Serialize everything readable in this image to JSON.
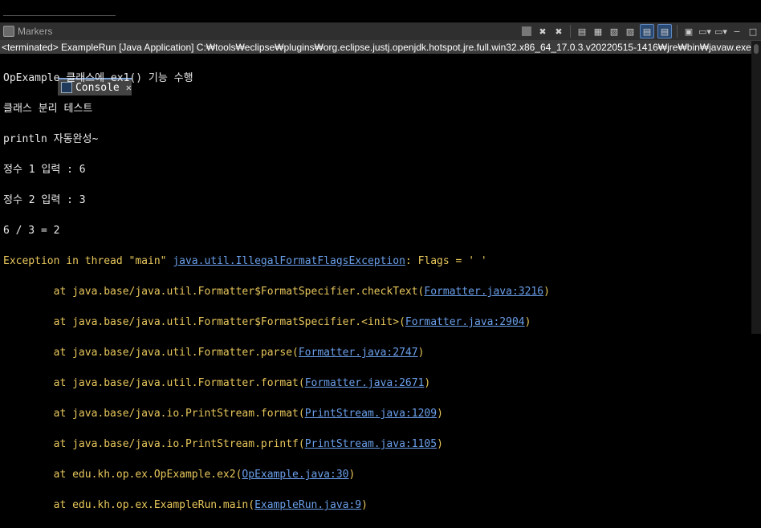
{
  "tabs": {
    "markers": "Markers",
    "console": "Console",
    "close": "✕"
  },
  "status_line": "<terminated> ExampleRun [Java Application] C:₩tools₩eclipse₩plugins₩org.eclipse.justj.openjdk.hotspot.jre.full.win32.x86_64_17.0.3.v20220515-1416₩jre₩bin₩javaw.exe  (20",
  "console": {
    "output_lines": [
      "OpExample 클래스에 ex1() 기능 수행",
      "클래스 분리 테스트",
      "println 자동완성~",
      "정수 1 입력 : 6",
      "정수 2 입력 : 3",
      "6 / 3 = 2"
    ],
    "exception": {
      "prefix": "Exception in thread \"main\" ",
      "type": "java.util.IllegalFormatFlagsException",
      "message": ": Flags = ' '"
    },
    "stack": [
      {
        "at": "\tat java.base/java.util.Formatter$FormatSpecifier.checkText(",
        "link": "Formatter.java:3216",
        "end": ")"
      },
      {
        "at": "\tat java.base/java.util.Formatter$FormatSpecifier.<init>(",
        "link": "Formatter.java:2904",
        "end": ")"
      },
      {
        "at": "\tat java.base/java.util.Formatter.parse(",
        "link": "Formatter.java:2747",
        "end": ")"
      },
      {
        "at": "\tat java.base/java.util.Formatter.format(",
        "link": "Formatter.java:2671",
        "end": ")"
      },
      {
        "at": "\tat java.base/java.io.PrintStream.format(",
        "link": "PrintStream.java:1209",
        "end": ")"
      },
      {
        "at": "\tat java.base/java.io.PrintStream.printf(",
        "link": "PrintStream.java:1105",
        "end": ")"
      },
      {
        "at": "\tat edu.kh.op.ex.OpExample.ex2(",
        "link": "OpExample.java:30",
        "end": ")"
      },
      {
        "at": "\tat edu.kh.op.ex.ExampleRun.main(",
        "link": "ExampleRun.java:9",
        "end": ")"
      }
    ]
  },
  "toolbar_icons": [
    "stop-icon",
    "remove-launch-icon",
    "remove-all-icon",
    "scroll-lock-icon",
    "word-wrap-icon",
    "clear-console-icon",
    "show-stdout-icon",
    "show-stderr-icon",
    "pin-console-icon",
    "display-console-icon",
    "new-console-icon"
  ]
}
